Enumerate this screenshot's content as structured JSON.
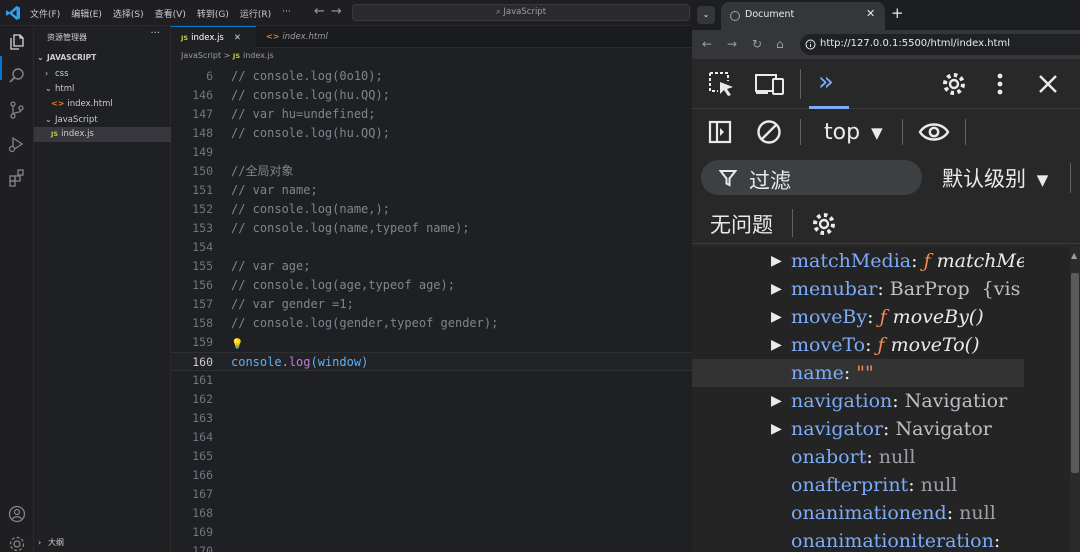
{
  "vscode": {
    "menu": [
      "文件(F)",
      "编辑(E)",
      "选择(S)",
      "查看(V)",
      "转到(G)",
      "运行(R)",
      "···"
    ],
    "search_placeholder": "JavaScript",
    "explorer": {
      "title": "资源管理器",
      "more": "···",
      "tree": [
        {
          "label": "JAVASCRIPT",
          "kind": "root"
        },
        {
          "label": "css",
          "kind": "folder"
        },
        {
          "label": "html",
          "kind": "folder"
        },
        {
          "label": "index.html",
          "kind": "html"
        },
        {
          "label": "JavaScript",
          "kind": "folder"
        },
        {
          "label": "index.js",
          "kind": "js"
        }
      ],
      "outline": "大纲"
    },
    "tabs": [
      {
        "label": "index.js",
        "close": "✕",
        "active": true
      },
      {
        "label": "index.html",
        "active": false
      }
    ],
    "breadcrumb": {
      "folder": "JavaScript",
      "sep": ">",
      "file": "index.js",
      "js_badge": "JS"
    },
    "lines": [
      {
        "n": "6",
        "text": "// console.log(0o10);"
      },
      {
        "n": "146",
        "text": "// console.log(hu.QQ);"
      },
      {
        "n": "147",
        "text": "// var hu=undefined;"
      },
      {
        "n": "148",
        "text": "// console.log(hu.QQ);"
      },
      {
        "n": "149",
        "text": ""
      },
      {
        "n": "150",
        "text": "//全局对象"
      },
      {
        "n": "151",
        "text": "// var name;"
      },
      {
        "n": "152",
        "text": "// console.log(name,);"
      },
      {
        "n": "153",
        "text": "// console.log(name,typeof name);"
      },
      {
        "n": "154",
        "text": ""
      },
      {
        "n": "155",
        "text": "// var age;"
      },
      {
        "n": "156",
        "text": "// console.log(age,typeof age);"
      },
      {
        "n": "157",
        "text": "// var gender =1;"
      },
      {
        "n": "158",
        "text": "// console.log(gender,typeof gender);"
      },
      {
        "n": "159",
        "text": ""
      },
      {
        "n": "160",
        "text": ""
      },
      {
        "n": "161",
        "text": ""
      },
      {
        "n": "162",
        "text": ""
      },
      {
        "n": "163",
        "text": ""
      },
      {
        "n": "164",
        "text": ""
      },
      {
        "n": "165",
        "text": ""
      },
      {
        "n": "166",
        "text": ""
      },
      {
        "n": "167",
        "text": ""
      },
      {
        "n": "168",
        "text": ""
      },
      {
        "n": "169",
        "text": ""
      },
      {
        "n": "170",
        "text": ""
      }
    ],
    "current_line": {
      "obj": "console",
      "dot": ".",
      "fn": "log",
      "args": "(window)"
    }
  },
  "browser": {
    "tab_title": "Document",
    "tab_close": "✕",
    "new_tab": "+",
    "url": "http://127.0.0.1:5500/html/index.html",
    "devtools": {
      "context": "top",
      "filter_label": "过滤",
      "levels": "默认级别",
      "issues": "无问题",
      "properties": [
        {
          "key": "matchMedia",
          "type": "fn",
          "value": "matchMec",
          "expandable": true
        },
        {
          "key": "menubar",
          "type": "obj",
          "value": "BarProp  {vis",
          "expandable": true
        },
        {
          "key": "moveBy",
          "type": "fn",
          "value": "moveBy()",
          "expandable": true
        },
        {
          "key": "moveTo",
          "type": "fn",
          "value": "moveTo()",
          "expandable": true
        },
        {
          "key": "name",
          "type": "str",
          "value": "\"\"",
          "expandable": false,
          "highlight": true
        },
        {
          "key": "navigation",
          "type": "obj",
          "value": "Navigatior",
          "expandable": true
        },
        {
          "key": "navigator",
          "type": "obj",
          "value": "Navigator",
          "expandable": true
        },
        {
          "key": "onabort",
          "type": "null",
          "value": "null",
          "expandable": false
        },
        {
          "key": "onafterprint",
          "type": "null",
          "value": "null",
          "expandable": false
        },
        {
          "key": "onanimationend",
          "type": "null",
          "value": "null",
          "expandable": false
        },
        {
          "key": "onanimationiteration",
          "type": "null",
          "value": "",
          "expandable": false
        }
      ]
    }
  },
  "colors": {
    "accent": "#0078d4",
    "devtools_key": "#7cacf8",
    "devtools_fn_marker": "#f28b54"
  }
}
